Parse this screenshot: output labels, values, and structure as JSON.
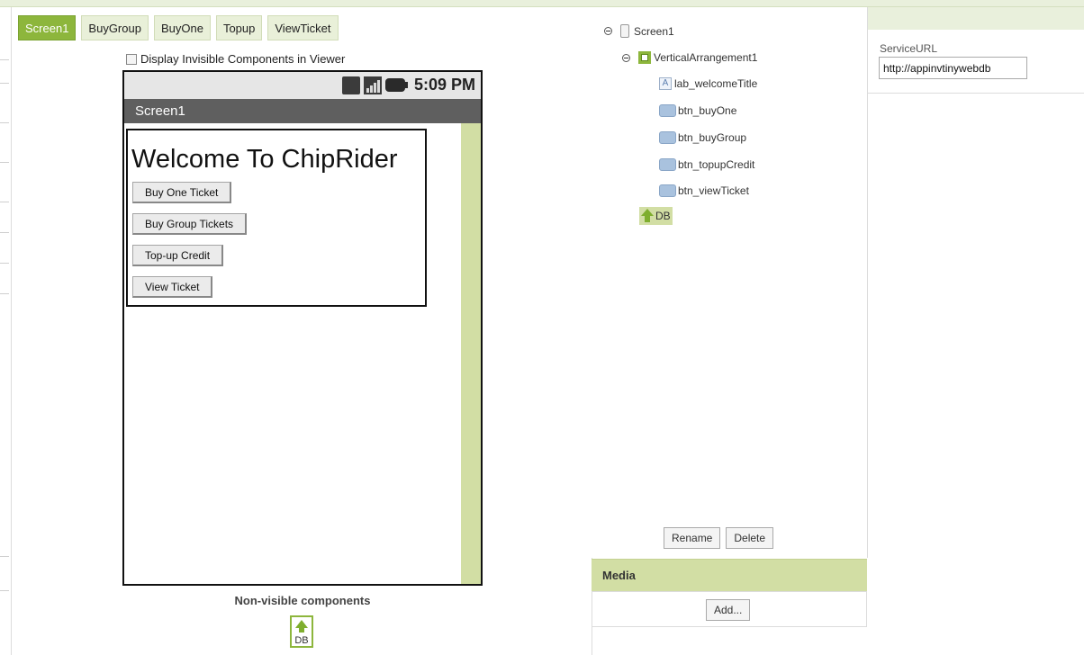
{
  "screen_tabs": [
    "Screen1",
    "BuyGroup",
    "BuyOne",
    "Topup",
    "ViewTicket"
  ],
  "active_tab": "Screen1",
  "viewer": {
    "display_invisible_label": "Display Invisible Components in Viewer",
    "display_invisible_checked": false,
    "status_time": "5:09 PM",
    "screen_title": "Screen1",
    "welcome_text": "Welcome To ChipRider",
    "buttons": [
      "Buy One Ticket",
      "Buy Group Tickets",
      "Top-up Credit",
      "View Ticket"
    ],
    "nonvisible_label": "Non-visible components",
    "nonvisible_db_label": "DB"
  },
  "tree": {
    "screen": "Screen1",
    "arrangement": "VerticalArrangement1",
    "children": [
      "lab_welcomeTitle",
      "btn_buyOne",
      "btn_buyGroup",
      "btn_topupCredit",
      "btn_viewTicket"
    ],
    "db": "DB",
    "rename_label": "Rename",
    "delete_label": "Delete"
  },
  "media": {
    "header": "Media",
    "add_label": "Add..."
  },
  "properties": {
    "label": "ServiceURL",
    "value": "http://appinvtinywebdb"
  },
  "colors": {
    "accent_green": "#8db63c",
    "light_green": "#d2dea4",
    "tab_bg": "#e9f0d9"
  }
}
